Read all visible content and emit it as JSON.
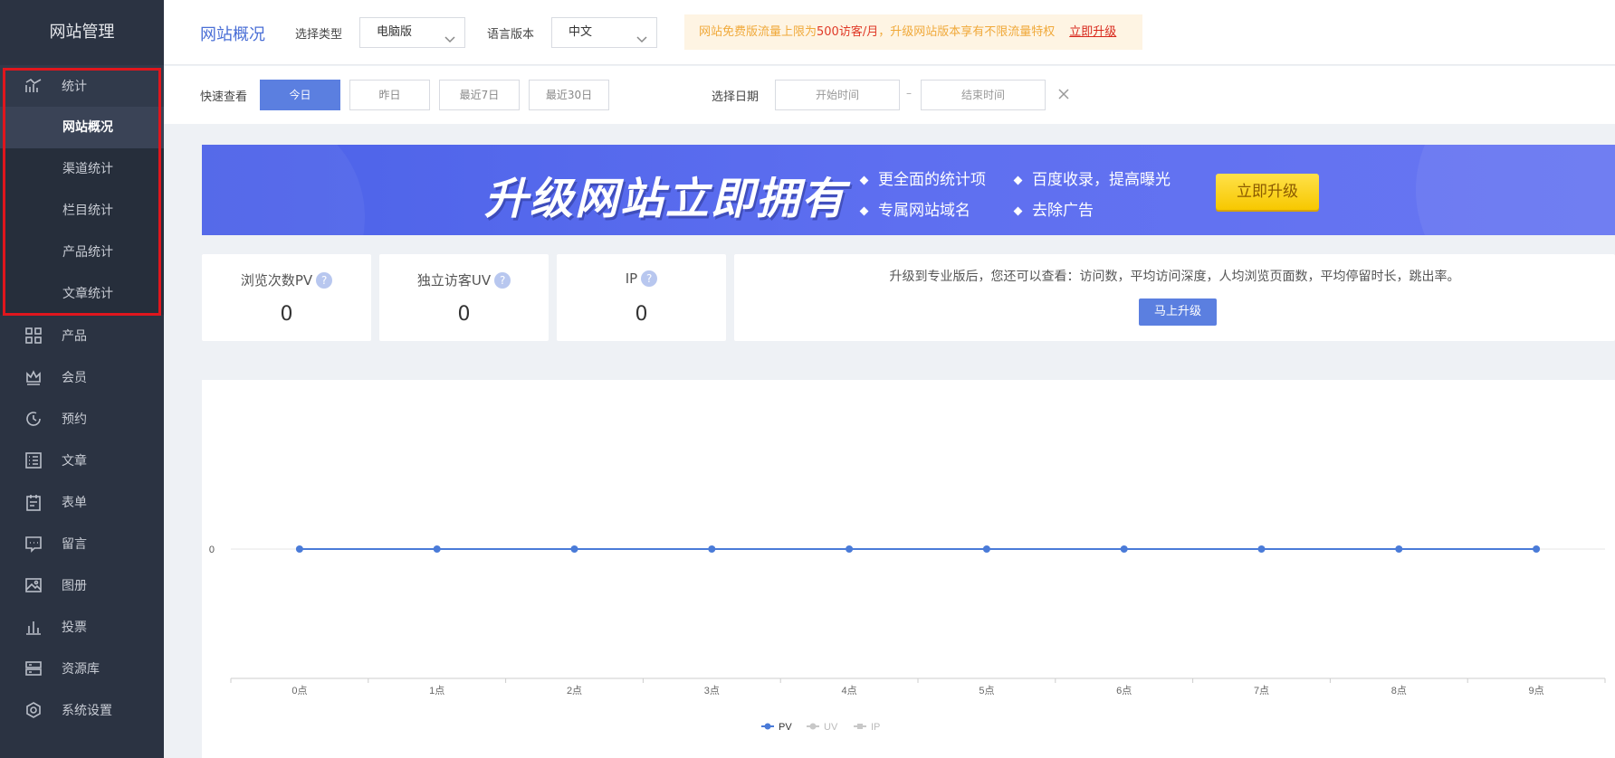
{
  "sidebar": {
    "brand": "网站管理",
    "stats_label": "统计",
    "sub_items": [
      "网站概况",
      "渠道统计",
      "栏目统计",
      "产品统计",
      "文章统计"
    ],
    "items": [
      {
        "label": "产品",
        "icon": "grid-icon"
      },
      {
        "label": "会员",
        "icon": "crown-icon"
      },
      {
        "label": "预约",
        "icon": "clock-icon"
      },
      {
        "label": "文章",
        "icon": "list-icon"
      },
      {
        "label": "表单",
        "icon": "clipboard-icon"
      },
      {
        "label": "留言",
        "icon": "message-icon"
      },
      {
        "label": "图册",
        "icon": "image-icon"
      },
      {
        "label": "投票",
        "icon": "bar-chart-icon"
      },
      {
        "label": "资源库",
        "icon": "storage-icon"
      },
      {
        "label": "系统设置",
        "icon": "settings-icon"
      }
    ]
  },
  "header": {
    "title": "网站概况",
    "type_label": "选择类型",
    "type_value": "电脑版",
    "lang_label": "语言版本",
    "lang_value": "中文",
    "notice_pre": "网站免费版流量上限为",
    "notice_red": "500访客/月",
    "notice_post": "，升级网站版本享有不限流量特权",
    "notice_link": "立即升级"
  },
  "quick": {
    "label": "快速查看",
    "buttons": [
      "今日",
      "昨日",
      "最近7日",
      "最近30日"
    ],
    "active_index": 0,
    "date_label": "选择日期",
    "start_placeholder": "开始时间",
    "end_placeholder": "结束时间",
    "dash": "–"
  },
  "banner": {
    "title": "升级网站立即拥有",
    "features": [
      "更全面的统计项",
      "百度收录，提高曝光",
      "专属网站域名",
      "去除广告"
    ],
    "button": "立即升级"
  },
  "stats": [
    {
      "label": "浏览次数PV",
      "value": "0",
      "help": "?"
    },
    {
      "label": "独立访客UV",
      "value": "0",
      "help": "?"
    },
    {
      "label": "IP",
      "value": "0",
      "help": "?"
    }
  ],
  "upgrade_card": {
    "message": "升级到专业版后，您还可以查看：访问数，平均访问深度，人均浏览页面数，平均停留时长，跳出率。",
    "button": "马上升级"
  },
  "chart_data": {
    "type": "line",
    "x": [
      "0点",
      "1点",
      "2点",
      "3点",
      "4点",
      "5点",
      "6点",
      "7点",
      "8点",
      "9点"
    ],
    "y_tick_labels": [
      "0"
    ],
    "series": [
      {
        "name": "PV",
        "values": [
          0,
          0,
          0,
          0,
          0,
          0,
          0,
          0,
          0,
          0
        ],
        "color": "#4a7bd8",
        "active": true
      },
      {
        "name": "UV",
        "values": [],
        "color": "#c8c8c8",
        "active": false
      },
      {
        "name": "IP",
        "values": [],
        "color": "#c8c8c8",
        "active": false
      }
    ],
    "legend_position": "bottom-center"
  }
}
